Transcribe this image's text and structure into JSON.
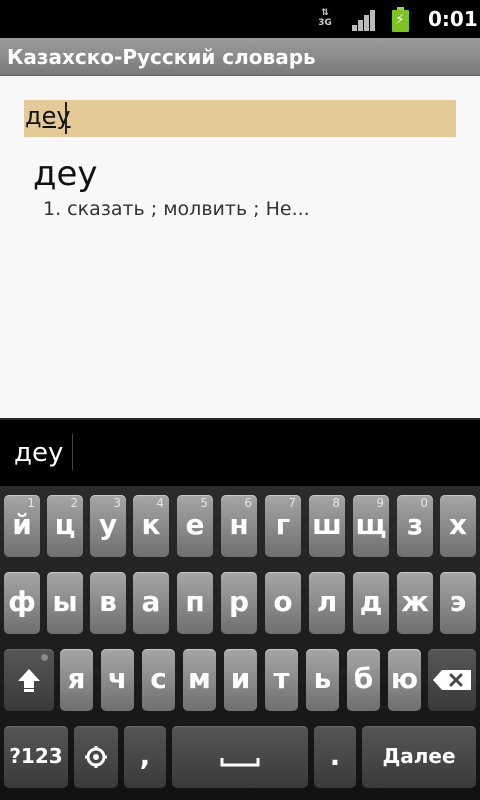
{
  "status_bar": {
    "network_label": "3G",
    "time": "0:01",
    "battery_color": "#7bc31e"
  },
  "app": {
    "title": "Казахско-Русский словарь"
  },
  "search": {
    "value": "деу"
  },
  "result": {
    "word": "деу",
    "definition": "1. сказать ; молвить ; Не..."
  },
  "suggestions": {
    "current": "деу"
  },
  "keyboard": {
    "row1": [
      {
        "label": "й",
        "hint": "1"
      },
      {
        "label": "ц",
        "hint": "2"
      },
      {
        "label": "у",
        "hint": "3"
      },
      {
        "label": "к",
        "hint": "4"
      },
      {
        "label": "е",
        "hint": "5"
      },
      {
        "label": "н",
        "hint": "6"
      },
      {
        "label": "г",
        "hint": "7"
      },
      {
        "label": "ш",
        "hint": "8"
      },
      {
        "label": "щ",
        "hint": "9"
      },
      {
        "label": "з",
        "hint": "0"
      },
      {
        "label": "х",
        "hint": ""
      }
    ],
    "row2": [
      "ф",
      "ы",
      "в",
      "а",
      "п",
      "р",
      "о",
      "л",
      "д",
      "ж",
      "э"
    ],
    "row3": [
      "я",
      "ч",
      "с",
      "м",
      "и",
      "т",
      "ь",
      "б",
      "ю"
    ],
    "symbols_label": "?123",
    "comma_label": ",",
    "period_label": ".",
    "enter_label": "Далее",
    "shift_icon": "shift-arrow-icon",
    "delete_icon": "backspace-icon",
    "settings_icon": "settings-icon",
    "space_icon": "space-icon"
  }
}
